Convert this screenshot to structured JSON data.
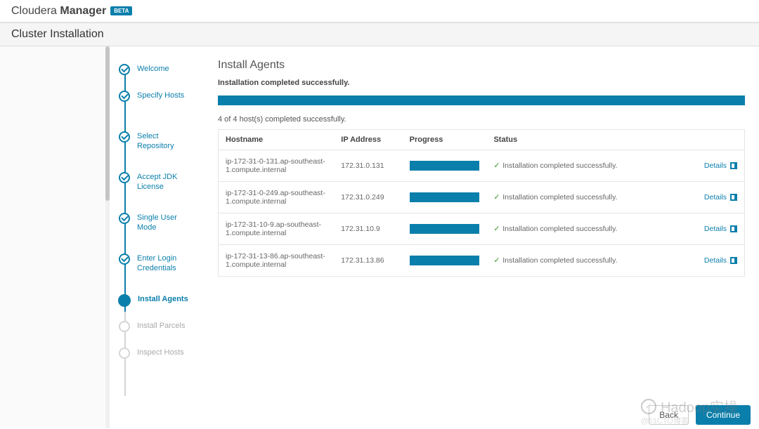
{
  "header": {
    "brand_light": "Cloudera",
    "brand_bold": "Manager",
    "badge": "BETA"
  },
  "sub_header": {
    "title": "Cluster Installation"
  },
  "wizard_steps": [
    {
      "label": "Welcome",
      "state": "done"
    },
    {
      "label": "Specify Hosts",
      "state": "done"
    },
    {
      "label": "Select Repository",
      "state": "done"
    },
    {
      "label": "Accept JDK License",
      "state": "done"
    },
    {
      "label": "Single User Mode",
      "state": "done"
    },
    {
      "label": "Enter Login Credentials",
      "state": "done"
    },
    {
      "label": "Install Agents",
      "state": "current"
    },
    {
      "label": "Install Parcels",
      "state": "pending"
    },
    {
      "label": "Inspect Hosts",
      "state": "pending"
    }
  ],
  "main": {
    "title": "Install Agents",
    "completion_message": "Installation completed successfully.",
    "summary": "4 of 4 host(s) completed successfully.",
    "columns": {
      "hostname": "Hostname",
      "ip": "IP Address",
      "progress": "Progress",
      "status": "Status"
    },
    "hosts": [
      {
        "hostname": "ip-172-31-0-131.ap-southeast-1.compute.internal",
        "ip": "172.31.0.131",
        "status": "Installation completed successfully.",
        "details": "Details"
      },
      {
        "hostname": "ip-172-31-0-249.ap-southeast-1.compute.internal",
        "ip": "172.31.0.249",
        "status": "Installation completed successfully.",
        "details": "Details"
      },
      {
        "hostname": "ip-172-31-10-9.ap-southeast-1.compute.internal",
        "ip": "172.31.10.9",
        "status": "Installation completed successfully.",
        "details": "Details"
      },
      {
        "hostname": "ip-172-31-13-86.ap-southeast-1.compute.internal",
        "ip": "172.31.13.86",
        "status": "Installation completed successfully.",
        "details": "Details"
      }
    ]
  },
  "footer": {
    "back": "Back",
    "continue": "Continue"
  },
  "watermark": {
    "main": "Hadoop实操",
    "sub": "@51CTO博客"
  }
}
